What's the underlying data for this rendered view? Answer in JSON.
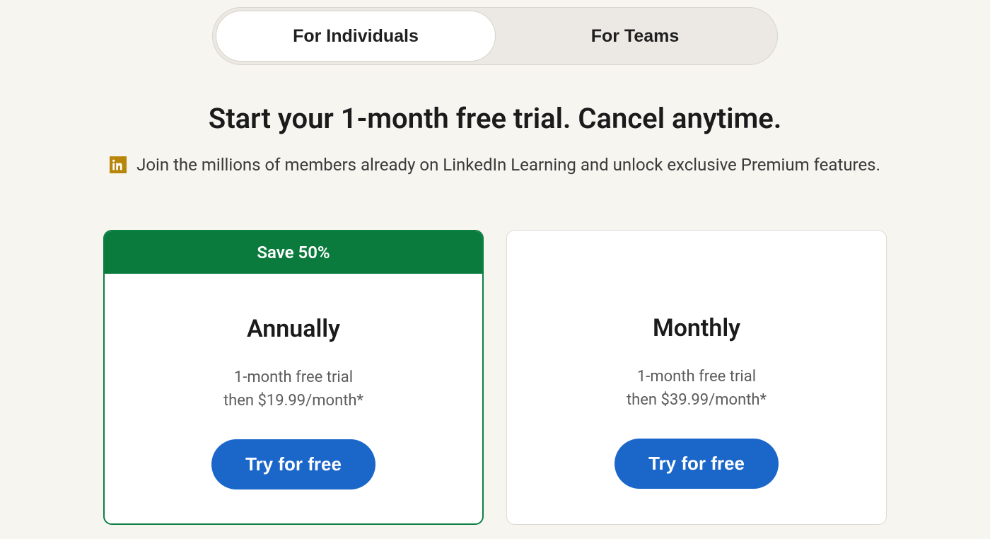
{
  "toggle": {
    "individuals": "For Individuals",
    "teams": "For Teams"
  },
  "headline": "Start your 1-month free trial. Cancel anytime.",
  "subline": "Join the millions of members already on LinkedIn Learning and unlock exclusive Premium features.",
  "plans": {
    "annually": {
      "badge": "Save 50%",
      "title": "Annually",
      "line1": "1-month free trial",
      "line2": "then $19.99/month*",
      "cta": "Try for free"
    },
    "monthly": {
      "title": "Monthly",
      "line1": "1-month free trial",
      "line2": "then $39.99/month*",
      "cta": "Try for free"
    }
  }
}
